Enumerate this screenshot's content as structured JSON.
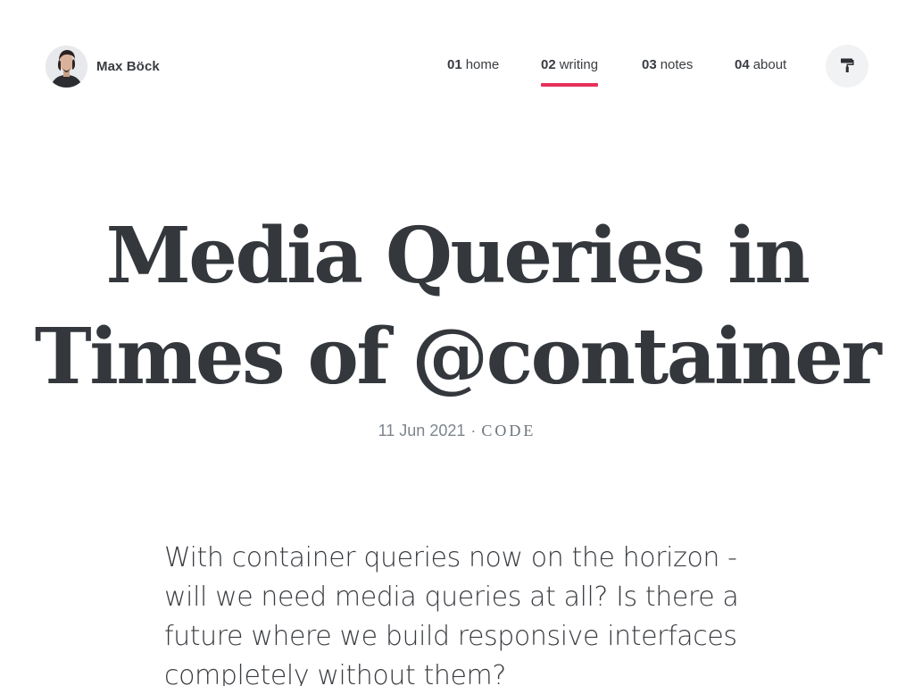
{
  "header": {
    "author_name": "Max Böck",
    "nav": [
      {
        "num": "01",
        "label": "home",
        "active": false
      },
      {
        "num": "02",
        "label": "writing",
        "active": true
      },
      {
        "num": "03",
        "label": "notes",
        "active": false
      },
      {
        "num": "04",
        "label": "about",
        "active": false
      }
    ],
    "theme_icon": "paint-roller-icon",
    "accent_color": "#e8305c"
  },
  "post": {
    "title_line1": "Media Queries in",
    "title_line2": "Times of @container",
    "date": "11 Jun 2021",
    "separator": "·",
    "tag": "CODE",
    "intro": "With container queries now on the horizon - will we need media queries at all? Is there a future where we build responsive interfaces completely without them?"
  }
}
